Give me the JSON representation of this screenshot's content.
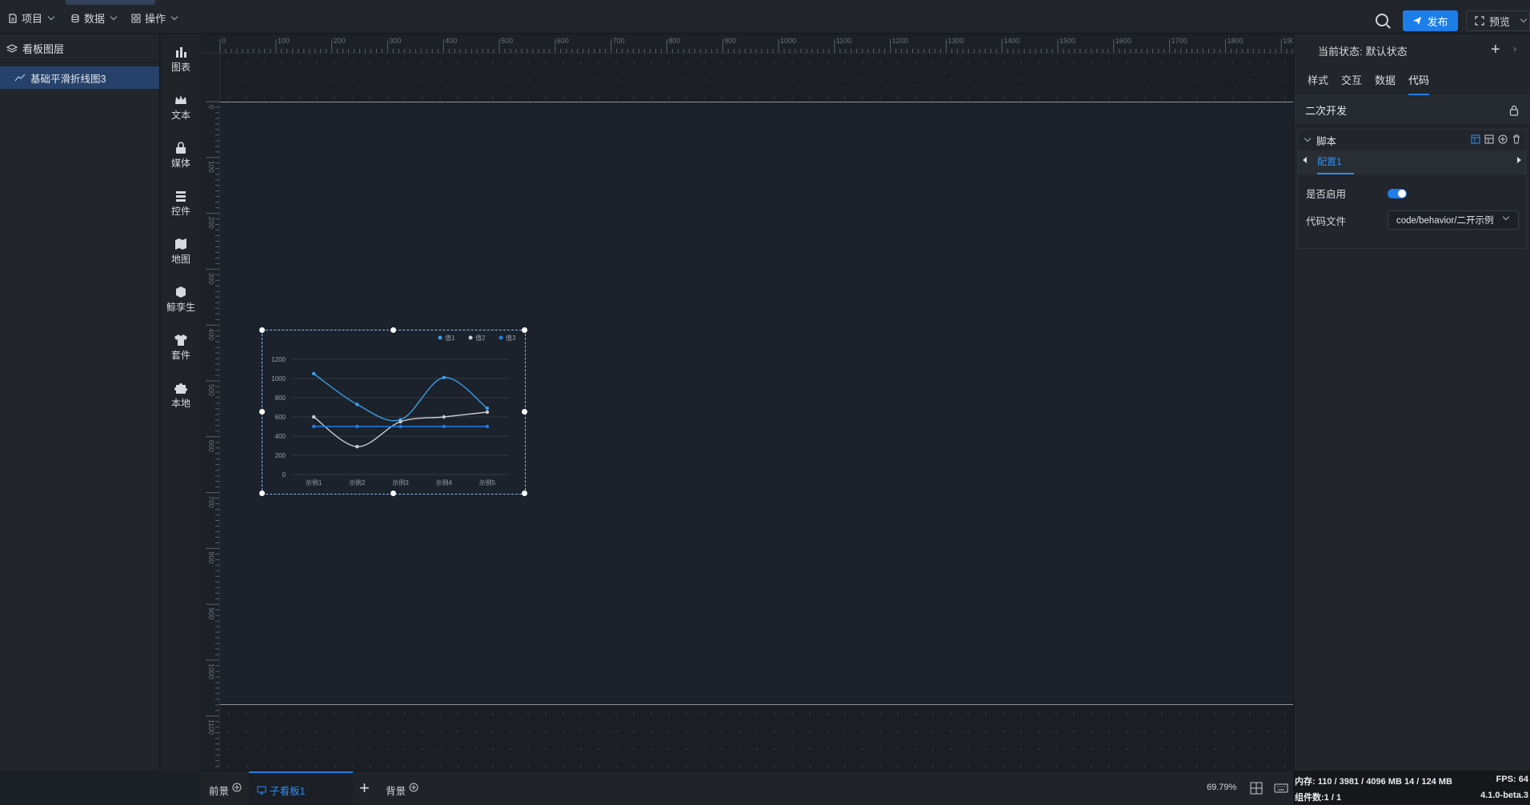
{
  "menu": {
    "project": "项目",
    "data": "数据",
    "operate": "操作"
  },
  "toolbar": {
    "publish": "发布",
    "preview": "预览"
  },
  "layers": {
    "title": "看板图层",
    "items": [
      {
        "label": "基础平滑折线图3",
        "icon": "line-chart-icon"
      }
    ]
  },
  "iconbar": [
    {
      "label": "图表",
      "icon": "bar-chart-icon"
    },
    {
      "label": "文本",
      "icon": "crown-icon"
    },
    {
      "label": "媒体",
      "icon": "lock-media-icon"
    },
    {
      "label": "控件",
      "icon": "layers-icon"
    },
    {
      "label": "地图",
      "icon": "map-icon"
    },
    {
      "label": "鲸孪生",
      "icon": "cube-icon"
    },
    {
      "label": "套件",
      "icon": "shirt-icon"
    },
    {
      "label": "本地",
      "icon": "puzzle-icon"
    }
  ],
  "ruler": {
    "top": [
      "0",
      "100",
      "200",
      "300",
      "400",
      "500",
      "600",
      "700",
      "800",
      "900",
      "1000",
      "1100",
      "1200",
      "1300",
      "1400",
      "1500",
      "1600",
      "1700",
      "1800",
      "1900"
    ],
    "left": [
      "0",
      "100",
      "200",
      "300",
      "400",
      "500",
      "600",
      "700",
      "800",
      "900",
      "1000",
      "1100",
      "1200"
    ]
  },
  "right_panel": {
    "state_label": "当前状态:",
    "state_value": "默认状态",
    "tabs": [
      "样式",
      "交互",
      "数据",
      "代码"
    ],
    "active_tab": "代码",
    "section_title": "二次开发",
    "script_title": "脚本",
    "config_tab": "配置1",
    "enabled_label": "是否启用",
    "enabled": true,
    "code_file_label": "代码文件",
    "code_file_value": "code/behavior/二开示例"
  },
  "bottom": {
    "foreground": "前景",
    "sub_board": "子看板1",
    "background": "背景",
    "zoom": "69.79%"
  },
  "status": {
    "memory": "内存: 110 / 3981 / 4096 MB  14 / 124 MB",
    "fps": "FPS: 64",
    "components": "组件数:1 / 1",
    "version": "4.1.0-beta.3"
  },
  "colors": {
    "accent": "#1c7ee9",
    "series1": "#3aa0e8",
    "series2": "#c9ccd2",
    "series3": "#1c7ee9"
  },
  "chart_data": {
    "type": "line",
    "smooth": true,
    "categories": [
      "示例1",
      "示例2",
      "示例3",
      "示例4",
      "示例5"
    ],
    "ylim": [
      0,
      1200
    ],
    "yticks": [
      "1200",
      "1000",
      "800",
      "600",
      "400",
      "200",
      "0"
    ],
    "series": [
      {
        "name": "值1",
        "values": [
          1050,
          730,
          570,
          1010,
          690
        ]
      },
      {
        "name": "值2",
        "values": [
          600,
          290,
          550,
          600,
          650
        ]
      },
      {
        "name": "值3",
        "values": [
          500,
          500,
          500,
          500,
          500
        ]
      }
    ],
    "legend": "top-right"
  }
}
